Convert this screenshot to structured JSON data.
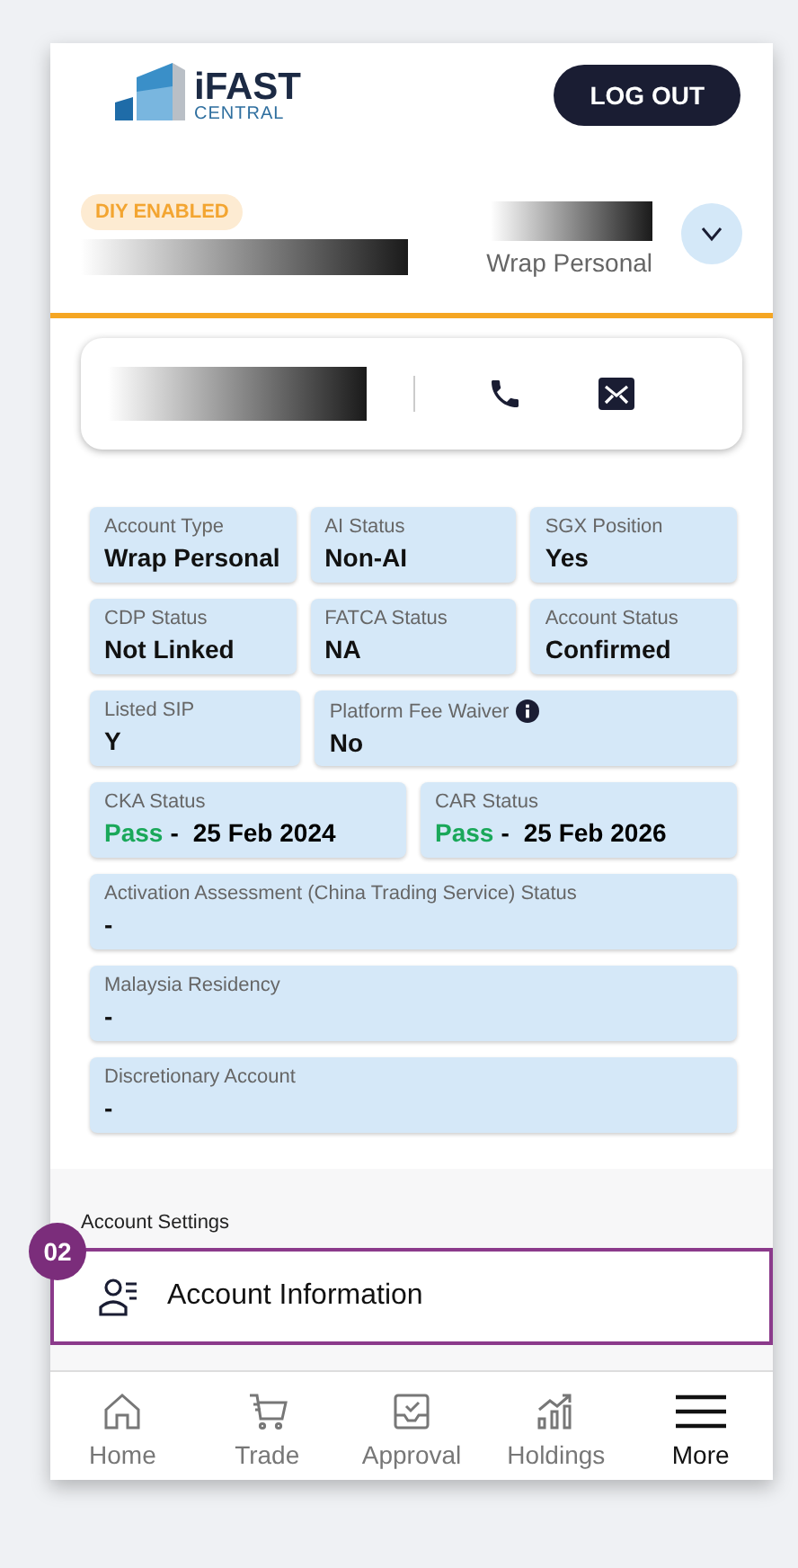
{
  "header": {
    "logo": {
      "name": "iFAST",
      "subtitle": "CENTRAL"
    },
    "logout_button": "LOG OUT"
  },
  "account": {
    "badge": "DIY ENABLED",
    "account_type": "Wrap Personal",
    "expanded": false
  },
  "info_rows": [
    [
      {
        "label": "Account Type",
        "value": "Wrap Personal"
      },
      {
        "label": "AI Status",
        "value": "Non-AI"
      },
      {
        "label": "SGX Position",
        "value": "Yes"
      }
    ],
    [
      {
        "label": "CDP Status",
        "value": "Not Linked"
      },
      {
        "label": "FATCA Status",
        "value": "NA"
      },
      {
        "label": "Account Status",
        "value": "Confirmed"
      }
    ],
    [
      {
        "label": "Listed SIP",
        "value": "Y"
      },
      {
        "label": "Platform Fee Waiver",
        "value": "No",
        "info": true
      }
    ],
    [
      {
        "label": "CKA Status",
        "status": "Pass",
        "separator": "-",
        "value": "25 Feb 2024"
      },
      {
        "label": "CAR Status",
        "status": "Pass",
        "separator": "-",
        "value": "25 Feb 2026"
      }
    ],
    [
      {
        "label": "Activation Assessment (China Trading Service) Status",
        "value": "-"
      }
    ],
    [
      {
        "label": "Malaysia Residency",
        "value": "-"
      }
    ],
    [
      {
        "label": "Discretionary Account",
        "value": "-"
      }
    ]
  ],
  "settings": {
    "title": "Account Settings",
    "items": [
      {
        "label": "Account Information",
        "highlighted": true,
        "callout": "02"
      }
    ]
  },
  "nav": [
    {
      "label": "Home",
      "kind": "home",
      "selected": false
    },
    {
      "label": "Trade",
      "kind": "cart",
      "selected": false
    },
    {
      "label": "Approval",
      "kind": "approval",
      "selected": false
    },
    {
      "label": "Holdings",
      "kind": "chart",
      "selected": false
    },
    {
      "label": "More",
      "kind": "menu",
      "selected": true
    }
  ]
}
